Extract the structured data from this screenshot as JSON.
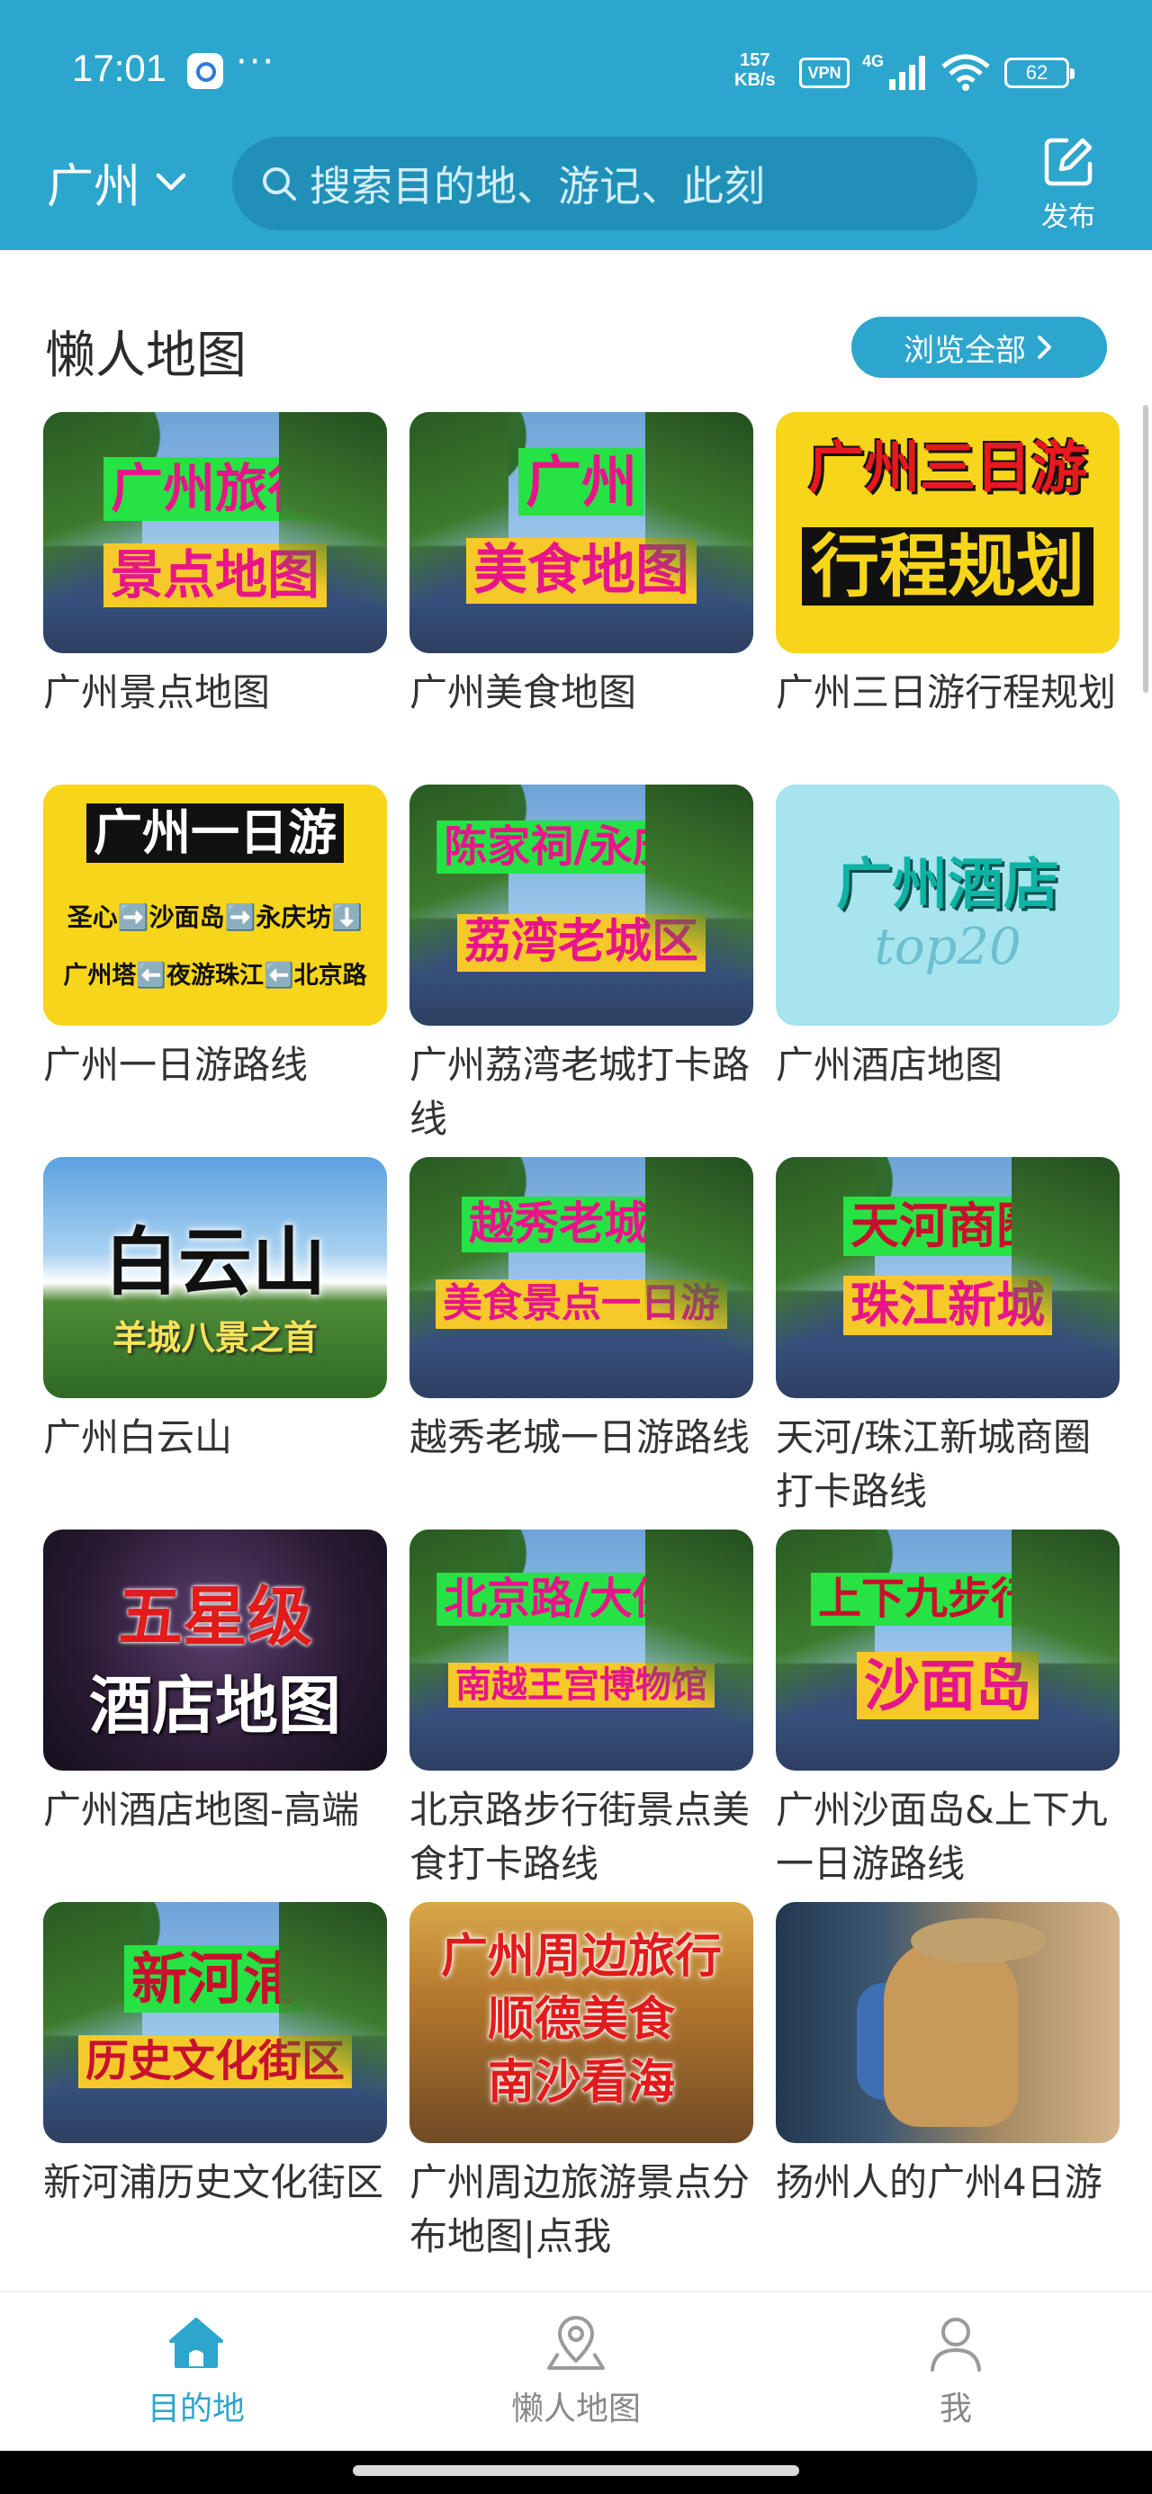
{
  "status_bar": {
    "time": "17:01",
    "dots": "···",
    "net_speed_value": "157",
    "net_speed_unit": "KB/s",
    "vpn": "VPN",
    "network": "4G",
    "battery": "62"
  },
  "header": {
    "city": "广州",
    "search_placeholder": "搜索目的地、游记、此刻",
    "publish_label": "发布",
    "accent_color": "#2da6cd"
  },
  "section": {
    "title": "懒人地图",
    "browse_all_label": "浏览全部"
  },
  "cards": [
    {
      "title": "广州景点地图",
      "thumb_lines": [
        "广州旅行",
        "景点地图"
      ]
    },
    {
      "title": "广州美食地图",
      "thumb_lines": [
        "广州",
        "美食地图"
      ]
    },
    {
      "title": "广州三日游行程规划",
      "thumb_lines": [
        "广州三日游",
        "行程规划"
      ]
    },
    {
      "title": "广州一日游路线",
      "thumb_lines": [
        "广州一日游",
        "圣心➡️沙面岛➡️永庆坊⬇️",
        "广州塔⬅️夜游珠江⬅️北京路"
      ]
    },
    {
      "title": "广州荔湾老城打卡路线",
      "thumb_lines": [
        "陈家祠/永庆坊",
        "荔湾老城区"
      ]
    },
    {
      "title": "广州酒店地图",
      "thumb_lines": [
        "广州酒店",
        "top20"
      ]
    },
    {
      "title": "广州白云山",
      "thumb_lines": [
        "白云山",
        "羊城八景之首"
      ]
    },
    {
      "title": "越秀老城一日游路线",
      "thumb_lines": [
        "越秀老城区",
        "美食景点一日游"
      ]
    },
    {
      "title": "天河/珠江新城商圈打卡路线",
      "thumb_lines": [
        "天河商圈",
        "珠江新城"
      ]
    },
    {
      "title": "广州酒店地图-高端",
      "thumb_lines": [
        "五星级",
        "酒店地图"
      ]
    },
    {
      "title": "北京路步行街景点美食打卡路线",
      "thumb_lines": [
        "北京路/大佛寺",
        "南越王宫博物馆"
      ]
    },
    {
      "title": "广州沙面岛&上下九一日游路线",
      "thumb_lines": [
        "上下九步行街",
        "沙面岛"
      ]
    },
    {
      "title": "新河浦历史文化街区",
      "thumb_lines": [
        "新河浦",
        "历史文化街区"
      ]
    },
    {
      "title": "广州周边旅游景点分布地图|点我",
      "thumb_lines": [
        "广州周边旅行",
        "顺德美食",
        "南沙看海"
      ]
    },
    {
      "title": "扬州人的广州4日游",
      "thumb_lines": []
    }
  ],
  "tab_bar": {
    "tabs": [
      {
        "label": "目的地",
        "icon": "home-icon",
        "active": true
      },
      {
        "label": "懒人地图",
        "icon": "map-pin-icon",
        "active": false
      },
      {
        "label": "我",
        "icon": "user-icon",
        "active": false
      }
    ]
  }
}
